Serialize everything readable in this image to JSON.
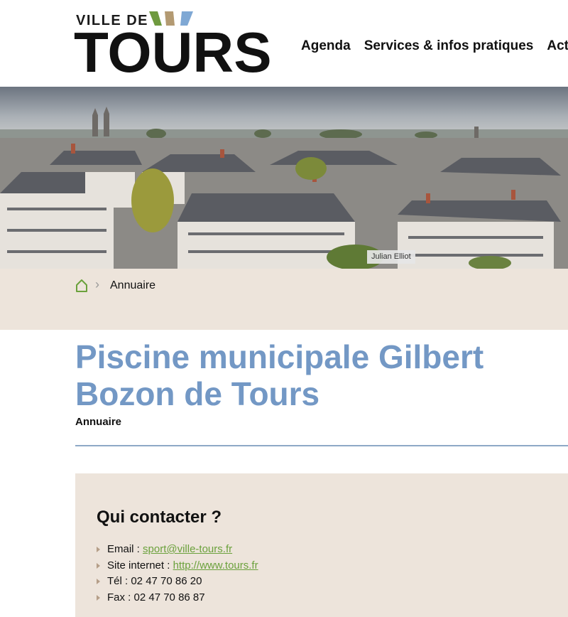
{
  "header": {
    "logo": {
      "small_text": "VILLE DE",
      "big_text": "TOURS"
    },
    "nav": [
      {
        "label": "Agenda"
      },
      {
        "label": "Services & infos pratiques"
      },
      {
        "label": "Action"
      }
    ]
  },
  "hero": {
    "photo_credit": "Julian Elliot"
  },
  "breadcrumb": {
    "home_icon": "home-icon",
    "current": "Annuaire"
  },
  "page": {
    "title": "Piscine municipale Gilbert Bozon de Tours",
    "category": "Annuaire"
  },
  "contact": {
    "heading": "Qui contacter ?",
    "items": [
      {
        "label": "Email : ",
        "value": "sport@ville-tours.fr",
        "link": true
      },
      {
        "label": "Site internet : ",
        "value": "http://www.tours.fr",
        "link": true
      },
      {
        "label": "Tél : ",
        "value": "02 47 70 86 20",
        "link": false
      },
      {
        "label": "Fax : ",
        "value": "02 47 70 86 87",
        "link": false
      }
    ]
  },
  "colors": {
    "title_blue": "#7398c5",
    "beige_band": "#ede4db",
    "link_green": "#6ba13c",
    "logo_mark_blue": "#7fa8d4",
    "logo_mark_tan": "#b39a72",
    "logo_mark_green": "#6f9a3f"
  }
}
